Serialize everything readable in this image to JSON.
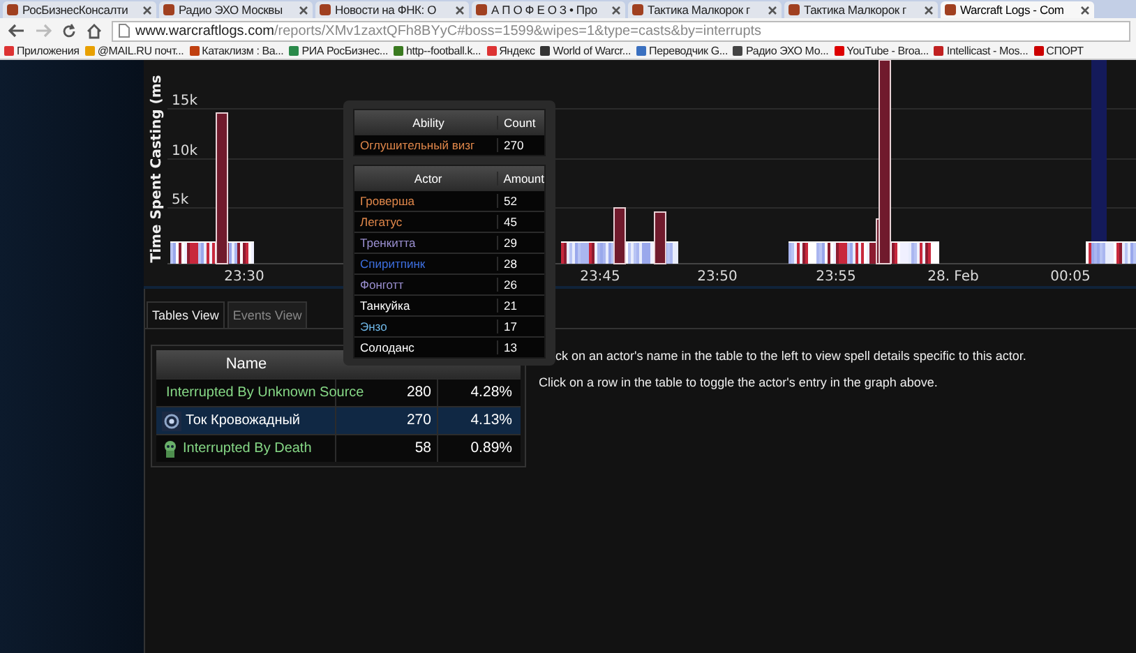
{
  "browser": {
    "tabs": [
      {
        "title": "РосБизнесКонсалти",
        "selected": false
      },
      {
        "title": "Радио ЭХО Москвы",
        "selected": false
      },
      {
        "title": "Новости на ФНК: О",
        "selected": false
      },
      {
        "title": "А П О Ф Е О З • Про",
        "selected": false
      },
      {
        "title": "Тактика Малкорок г",
        "selected": false
      },
      {
        "title": "Тактика Малкорок г",
        "selected": false
      },
      {
        "title": "Warcraft Logs - Com",
        "selected": true
      }
    ],
    "url_host": "www.warcraftlogs.com",
    "url_path": "/reports/XMv1zaxtQFh8BYyC#boss=1599&wipes=1&type=casts&by=interrupts",
    "bookmarks": [
      "Приложения",
      "@MAIL.RU почт...",
      "Катаклизм : Ва...",
      "РИА РосБизнес...",
      "http--football.k...",
      "Яндекс",
      "World of Warcr...",
      "Переводчик G...",
      "Радио ЭХО Мо...",
      "YouTube - Broa...",
      "Intellicast - Mos...",
      "СПОРТ"
    ]
  },
  "chart": {
    "ylabel": "Time Spent Casting (ms",
    "yticks": [
      "15k",
      "10k",
      "5k"
    ],
    "xticks": [
      "23:30",
      "23:45",
      "23:50",
      "23:55",
      "28. Feb",
      "00:05"
    ]
  },
  "view_tabs": [
    {
      "label": "Tables View",
      "selected": true
    },
    {
      "label": "Events View",
      "selected": false
    }
  ],
  "table": {
    "columns": [
      "Name"
    ],
    "rows": [
      {
        "kind": "unknown",
        "name": "Interrupted By Unknown Source",
        "count": "280",
        "percent": "4.28%",
        "color": "#86d886",
        "selected": false
      },
      {
        "kind": "spell",
        "name": "Ток Кровожадный",
        "count": "270",
        "percent": "4.13%",
        "color": "#ffffff",
        "selected": true
      },
      {
        "kind": "death",
        "name": "Interrupted By Death",
        "count": "58",
        "percent": "0.89%",
        "color": "#86d886",
        "selected": false
      }
    ]
  },
  "instructions": [
    "ck on an actor's name in the table to the left to view spell details specific to this actor.",
    "Click on a row in the table to toggle the actor's entry in the graph above."
  ],
  "tooltip": {
    "ability_columns": [
      "Ability",
      "Count"
    ],
    "ability": {
      "name": "Оглушительный визг",
      "count": "270",
      "color": "#e0874a"
    },
    "actor_columns": [
      "Actor",
      "Amount"
    ],
    "actors": [
      {
        "name": "Гроверша",
        "amount": "52",
        "color": "#e0874a"
      },
      {
        "name": "Легатус",
        "amount": "45",
        "color": "#e0874a"
      },
      {
        "name": "Тренкитта",
        "amount": "29",
        "color": "#9a8fd0"
      },
      {
        "name": "Спиритпинк",
        "amount": "28",
        "color": "#3d6fe0"
      },
      {
        "name": "Фонготт",
        "amount": "26",
        "color": "#9a8fd0"
      },
      {
        "name": "Танкуйка",
        "amount": "21",
        "color": "#ffffff"
      },
      {
        "name": "Энзо",
        "amount": "17",
        "color": "#6fb8e8"
      },
      {
        "name": "Солоданс",
        "amount": "13",
        "color": "#ffffff"
      }
    ]
  }
}
